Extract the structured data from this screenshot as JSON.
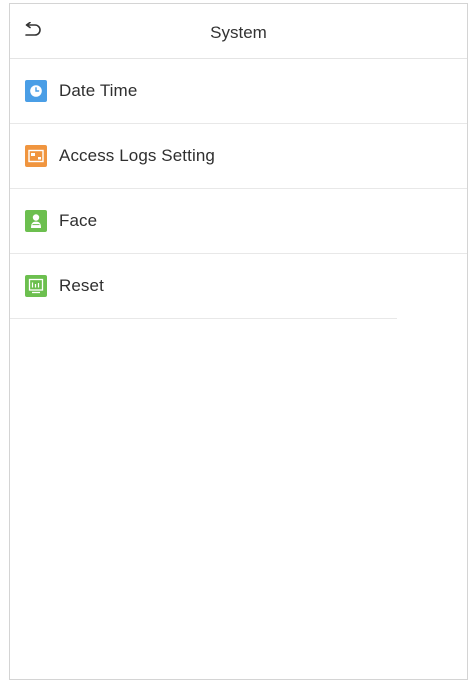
{
  "header": {
    "title": "System",
    "back_icon": "back-arrow-icon"
  },
  "menu": {
    "items": [
      {
        "label": "Date Time",
        "icon": "clock-icon",
        "color": "#4a9ee6"
      },
      {
        "label": "Access Logs Setting",
        "icon": "log-settings-icon",
        "color": "#f0953f"
      },
      {
        "label": "Face",
        "icon": "face-icon",
        "color": "#6cbf4f"
      },
      {
        "label": "Reset",
        "icon": "reset-icon",
        "color": "#6cbf4f"
      }
    ]
  }
}
